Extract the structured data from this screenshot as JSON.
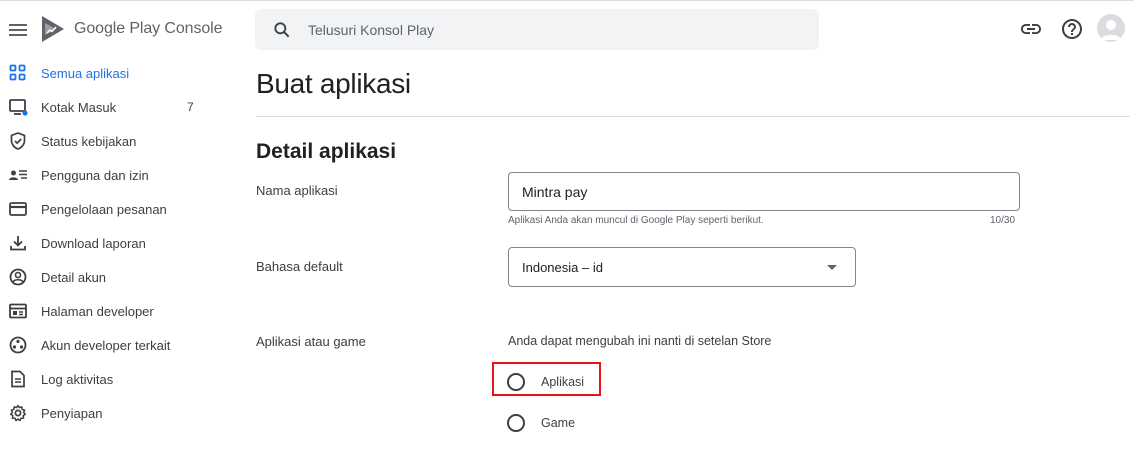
{
  "header": {
    "product_name": "Google Play Console",
    "search": {
      "placeholder": "Telusuri Konsol Play"
    },
    "icons": [
      "menu-icon",
      "link-icon",
      "help-icon",
      "account-avatar"
    ]
  },
  "sidebar": {
    "items": [
      {
        "label": "Semua aplikasi",
        "icon": "apps-grid-icon",
        "active": true
      },
      {
        "label": "Kotak Masuk",
        "icon": "inbox-icon",
        "count": "7"
      },
      {
        "label": "Status kebijakan",
        "icon": "shield-icon"
      },
      {
        "label": "Pengguna dan izin",
        "icon": "users-list-icon"
      },
      {
        "label": "Pengelolaan pesanan",
        "icon": "credit-card-icon"
      },
      {
        "label": "Download laporan",
        "icon": "download-icon"
      },
      {
        "label": "Detail akun",
        "icon": "account-circle-icon"
      },
      {
        "label": "Halaman developer",
        "icon": "developer-page-icon"
      },
      {
        "label": "Akun developer terkait",
        "icon": "linked-accounts-icon"
      },
      {
        "label": "Log aktivitas",
        "icon": "document-icon"
      },
      {
        "label": "Penyiapan",
        "icon": "gear-icon"
      }
    ]
  },
  "main": {
    "title": "Buat aplikasi",
    "section_title": "Detail aplikasi",
    "app_name": {
      "label": "Nama aplikasi",
      "value": "Mintra pay",
      "helper": "Aplikasi Anda akan muncul di Google Play seperti berikut.",
      "counter": "10/30"
    },
    "default_language": {
      "label": "Bahasa default",
      "value": "Indonesia – id"
    },
    "app_or_game": {
      "label": "Aplikasi atau game",
      "hint": "Anda dapat mengubah ini nanti di setelan Store",
      "options": [
        "Aplikasi",
        "Game"
      ],
      "highlighted_option": "Aplikasi"
    }
  },
  "colors": {
    "accent": "#1a73e8",
    "highlight_box": "#e8141a",
    "notification_dot": "#1a73e8"
  }
}
